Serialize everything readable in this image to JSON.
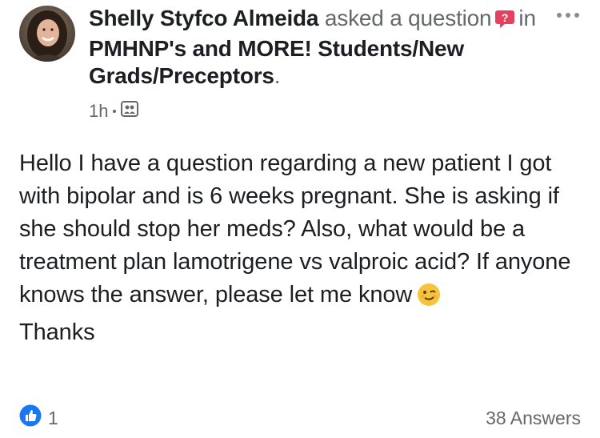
{
  "post": {
    "author": "Shelly Styfco Almeida",
    "action_pre": "asked a question",
    "action_in": "in",
    "group": "PMHNP's and MORE! Students/New Grads/Preceptors",
    "period": ".",
    "time": "1h",
    "privacy_icon": "group-members-icon",
    "body_lines": [
      "Hello I have a question regarding a new patient I got with bipolar and is 6 weeks pregnant. She is asking if she should stop her meds? Also, what would be a treatment plan lamotrigene vs valproic acid? If anyone knows the answer, please let me know",
      "Thanks"
    ],
    "emoji": "winking-face",
    "reaction_icon": "thumbs-up-icon",
    "reaction_count": "1",
    "answers_label": "38 Answers"
  },
  "colors": {
    "text": "#1c1e21",
    "muted": "#65676b",
    "like_blue": "#1877f2",
    "question_pink": "#e4405f",
    "emoji_yellow": "#f7c33b"
  }
}
